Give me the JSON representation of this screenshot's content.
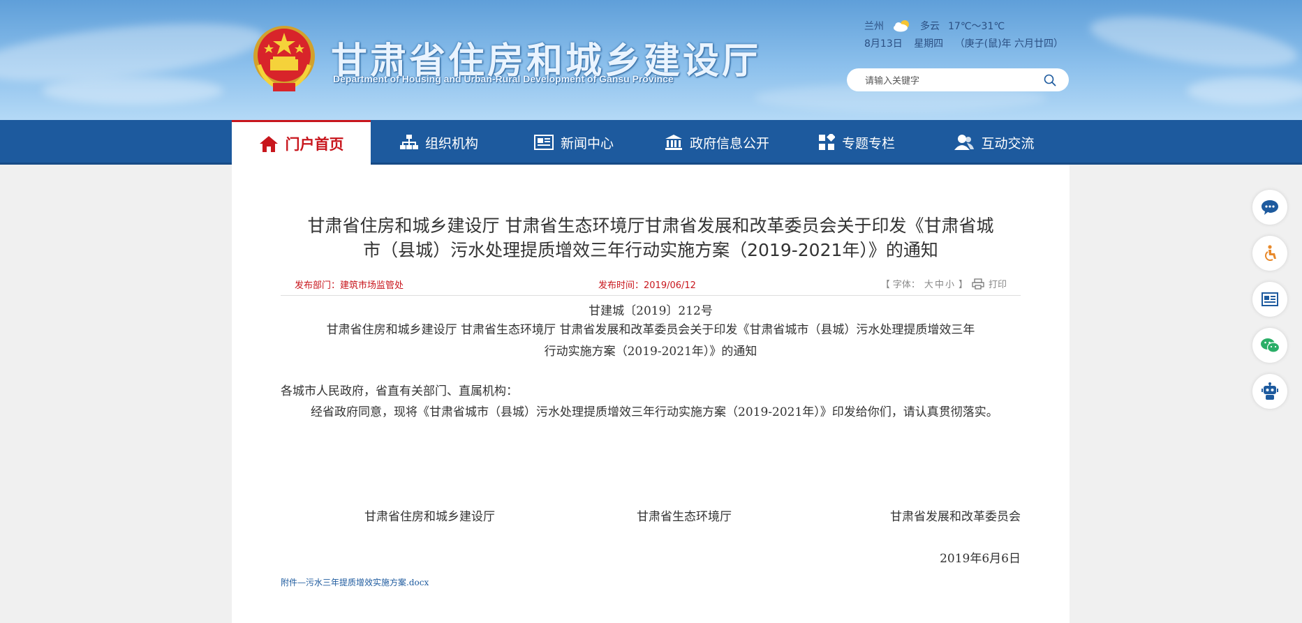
{
  "header": {
    "site_title": "甘肃省住房和城乡建设厅",
    "site_subtitle": "Department of Housing and Urban-Rural Development of Gansu Province",
    "weather": {
      "city": "兰州",
      "condition": "多云",
      "temperature": "17℃～31℃",
      "date": "8月13日",
      "weekday": "星期四",
      "lunar": "（庚子(鼠)年 六月廿四）",
      "icon": "partly-cloudy-icon"
    },
    "search": {
      "placeholder": "请输入关键字",
      "value": ""
    }
  },
  "nav": {
    "items": [
      {
        "label": "门户首页",
        "icon": "home-icon",
        "active": true
      },
      {
        "label": "组织机构",
        "icon": "org-chart-icon"
      },
      {
        "label": "新闻中心",
        "icon": "newspaper-icon"
      },
      {
        "label": "政府信息公开",
        "icon": "government-building-icon"
      },
      {
        "label": "专题专栏",
        "icon": "grid-icon"
      },
      {
        "label": "互动交流",
        "icon": "users-icon"
      }
    ]
  },
  "article": {
    "title_line1": "甘肃省住房和城乡建设厅 甘肃省生态环境厅甘肃省发展和改革委员会关于印发《甘肃省城",
    "title_line2": "市（县城）污水处理提质增效三年行动实施方案（2019-2021年）》的通知",
    "department_label": "发布部门：",
    "department": "建筑市场监管处",
    "publish_time_label": "发布时间：",
    "publish_time": "2019/06/12",
    "font_size_label": "【 字体：",
    "font_large": "大",
    "font_medium": "中",
    "font_small": "小",
    "font_size_end": "】",
    "print_label": "打印",
    "doc_number": "甘建城〔2019〕212号",
    "doc_title_line1": "甘肃省住房和城乡建设厅  甘肃省生态环境厅  甘肃省发展和改革委员会关于印发《甘肃省城市（县城）污水处理提质增效三年",
    "doc_title_line2": "行动实施方案（2019-2021年）》的通知",
    "salutation": "各城市人民政府，省直有关部门、直属机构：",
    "body": "经省政府同意，现将《甘肃省城市（县城）污水处理提质增效三年行动实施方案（2019-2021年）》印发给你们，请认真贯彻落实。",
    "signatories": [
      "甘肃省住房和城乡建设厅",
      "甘肃省生态环境厅",
      "甘肃省发展和改革委员会"
    ],
    "sign_date": "2019年6月6日",
    "attachment": "附件—污水三年提质增效实施方案.docx"
  },
  "side_tools": [
    "chat-bubble-icon",
    "accessibility-icon",
    "news-icon",
    "wechat-icon",
    "robot-icon"
  ],
  "colors": {
    "nav_blue": "#1d5a9e",
    "accent_red": "#c8161d",
    "side_orange": "#e8892a"
  }
}
